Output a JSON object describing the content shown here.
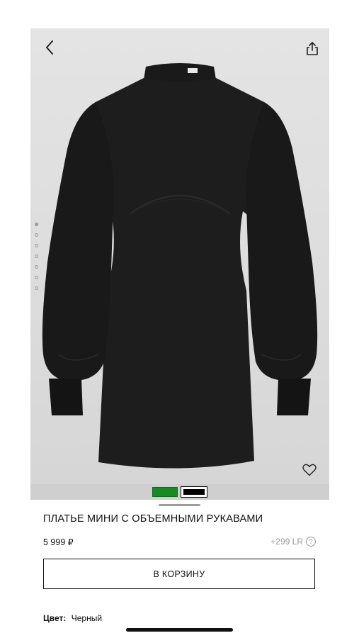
{
  "product": {
    "title": "ПЛАТЬЕ МИНИ С ОБЪЕМНЫМИ РУКАВАМИ",
    "price": "5 999 ₽",
    "bonus": "+299 LR",
    "help_glyph": "?"
  },
  "gallery": {
    "image_count": 7,
    "active_index": 0
  },
  "colors": {
    "options": [
      {
        "name": "green",
        "hex": "#168a23"
      },
      {
        "name": "black",
        "hex": "#000000"
      }
    ],
    "selected": "black"
  },
  "actions": {
    "cart_label": "В КОРЗИНУ"
  },
  "color_info": {
    "label": "Цвет:",
    "value": "Черный"
  },
  "icons": {
    "back": "chevron-left-icon",
    "share": "share-icon",
    "favorite": "heart-icon",
    "help": "help-icon"
  }
}
